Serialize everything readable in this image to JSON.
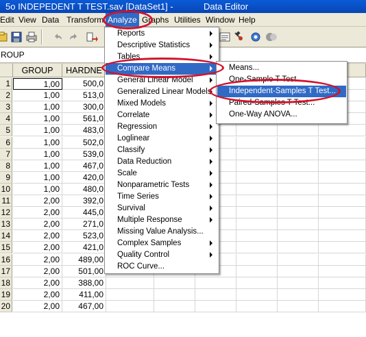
{
  "window": {
    "title_left": "5o INDEPEDENT T TEST.sav [DataSet1] -",
    "title_right": "Data Editor"
  },
  "menubar": {
    "items": [
      "Edit",
      "View",
      "Data",
      "Transform",
      "Analyze",
      "Graphs",
      "Utilities",
      "Window",
      "Help"
    ],
    "active": "Analyze"
  },
  "toolbar": {
    "icons": [
      "open-icon",
      "save-icon",
      "print-icon",
      "undo-icon",
      "redo-icon",
      "goto-case-icon",
      "variables-icon",
      "find-icon",
      "value-labels-icon",
      "use-sets-icon",
      "spell-icon"
    ]
  },
  "cell_editor": {
    "variable_name": "ROUP"
  },
  "grid": {
    "columns": [
      "GROUP",
      "HARDNE"
    ],
    "rows": [
      {
        "n": "1",
        "group": "1,00",
        "hard": "500,0"
      },
      {
        "n": "2",
        "group": "1,00",
        "hard": "513,0"
      },
      {
        "n": "3",
        "group": "1,00",
        "hard": "300,0"
      },
      {
        "n": "4",
        "group": "1,00",
        "hard": "561,0"
      },
      {
        "n": "5",
        "group": "1,00",
        "hard": "483,0"
      },
      {
        "n": "6",
        "group": "1,00",
        "hard": "502,0"
      },
      {
        "n": "7",
        "group": "1,00",
        "hard": "539,0"
      },
      {
        "n": "8",
        "group": "1,00",
        "hard": "467,0"
      },
      {
        "n": "9",
        "group": "1,00",
        "hard": "420,0"
      },
      {
        "n": "10",
        "group": "1,00",
        "hard": "480,0"
      },
      {
        "n": "11",
        "group": "2,00",
        "hard": "392,0"
      },
      {
        "n": "12",
        "group": "2,00",
        "hard": "445,0"
      },
      {
        "n": "13",
        "group": "2,00",
        "hard": "271,0"
      },
      {
        "n": "14",
        "group": "2,00",
        "hard": "523,0"
      },
      {
        "n": "15",
        "group": "2,00",
        "hard": "421,0"
      },
      {
        "n": "16",
        "group": "2,00",
        "hard": "489,00"
      },
      {
        "n": "17",
        "group": "2,00",
        "hard": "501,00"
      },
      {
        "n": "18",
        "group": "2,00",
        "hard": "388,00"
      },
      {
        "n": "19",
        "group": "2,00",
        "hard": "411,00"
      },
      {
        "n": "20",
        "group": "2,00",
        "hard": "467,00"
      }
    ]
  },
  "analyze_menu": {
    "items": [
      {
        "label": "Reports",
        "submenu": true
      },
      {
        "label": "Descriptive Statistics",
        "submenu": true
      },
      {
        "label": "Tables",
        "submenu": true
      },
      {
        "label": "Compare Means",
        "submenu": true,
        "highlighted": true
      },
      {
        "label": "General Linear Model",
        "submenu": true
      },
      {
        "label": "Generalized Linear Models",
        "submenu": true
      },
      {
        "label": "Mixed Models",
        "submenu": true
      },
      {
        "label": "Correlate",
        "submenu": true
      },
      {
        "label": "Regression",
        "submenu": true
      },
      {
        "label": "Loglinear",
        "submenu": true
      },
      {
        "label": "Classify",
        "submenu": true
      },
      {
        "label": "Data Reduction",
        "submenu": true
      },
      {
        "label": "Scale",
        "submenu": true
      },
      {
        "label": "Nonparametric Tests",
        "submenu": true
      },
      {
        "label": "Time Series",
        "submenu": true
      },
      {
        "label": "Survival",
        "submenu": true
      },
      {
        "label": "Multiple Response",
        "submenu": true
      },
      {
        "label": "Missing Value Analysis...",
        "submenu": false
      },
      {
        "label": "Complex Samples",
        "submenu": true
      },
      {
        "label": "Quality Control",
        "submenu": true
      },
      {
        "label": "ROC Curve...",
        "submenu": false
      }
    ]
  },
  "compare_means_menu": {
    "items": [
      {
        "label": "Means..."
      },
      {
        "label": "One-Sample T Test..."
      },
      {
        "label": "Independent-Samples T Test...",
        "highlighted": true
      },
      {
        "label": "Paired-Samples T Test..."
      },
      {
        "label": "One-Way ANOVA..."
      }
    ]
  },
  "colors": {
    "highlight": "#316ac5",
    "annotation_ring": "#d3122b",
    "titlebar": "#0a5bd8"
  }
}
